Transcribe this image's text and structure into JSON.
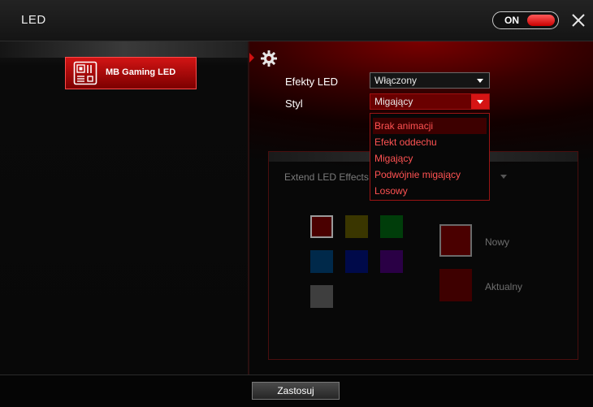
{
  "window": {
    "title": "LED"
  },
  "toggle": {
    "label": "ON"
  },
  "sidebar": {
    "items": [
      {
        "label": "MB Gaming LED",
        "icon": "motherboard-icon",
        "selected": true
      }
    ]
  },
  "settings": {
    "led_effects": {
      "label": "Efekty LED",
      "value": "Włączony"
    },
    "style": {
      "label": "Styl",
      "value": "Migający",
      "options": [
        "Brak animacji",
        "Efekt oddechu",
        "Migający",
        "Podwójnie migający",
        "Losowy"
      ],
      "highlighted_option": "Brak animacji"
    }
  },
  "extend": {
    "label": "Extend LED Effects",
    "palette": [
      "#4a0000",
      "#3a3600",
      "#003d0a",
      "#00294a",
      "#000a4a",
      "#2a0045",
      "#3e3e3e"
    ],
    "new_label": "Nowy",
    "new_color": "#4a0000",
    "current_label": "Aktualny",
    "current_color": "#3e0000"
  },
  "footer": {
    "apply_label": "Zastosuj"
  },
  "colors": {
    "accent": "#d51414"
  }
}
